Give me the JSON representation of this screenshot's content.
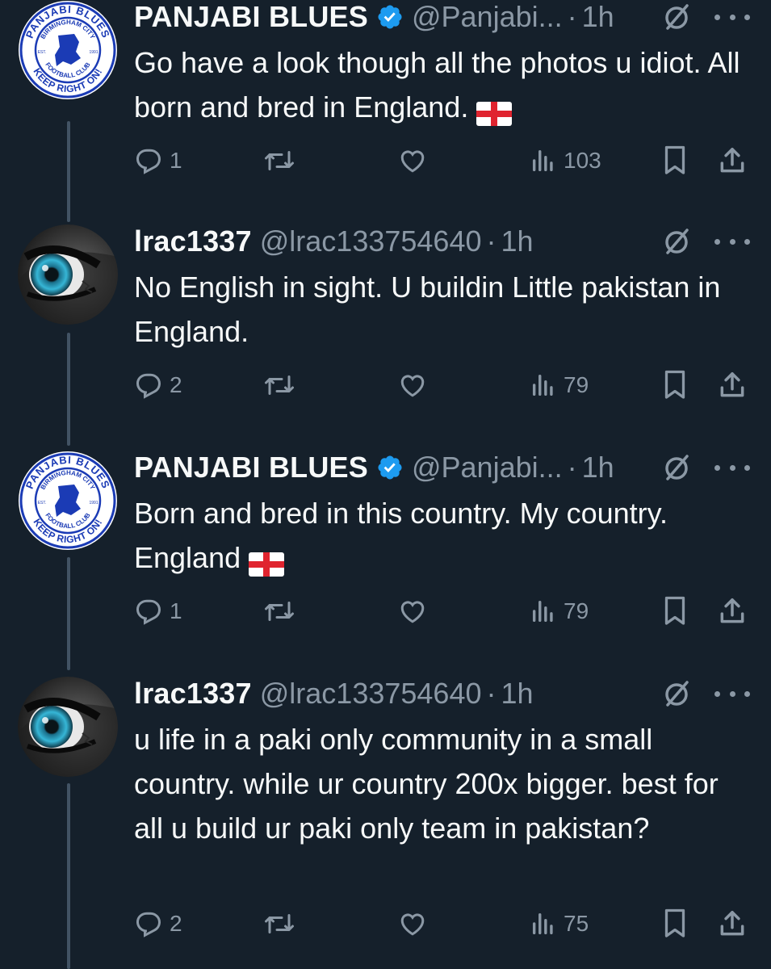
{
  "colors": {
    "background": "#15202b",
    "text_primary": "#f7f9f9",
    "text_secondary": "#8b98a5",
    "verified_blue": "#1d9bf0",
    "thread_line": "#425364"
  },
  "tweets": [
    {
      "author_name": "PANJABI BLUES",
      "handle": "@Panjabi...",
      "time": "1h",
      "verified": true,
      "avatar": "panjabi-blues-logo",
      "avatar_logo_top": "PANJABI BLUES",
      "avatar_logo_mid": "BIRMINGHAM CITY",
      "avatar_logo_sub": "FOOTBALL CLUB",
      "avatar_logo_bottom": "KEEP RIGHT ON!",
      "avatar_est": "EST.",
      "avatar_year": "1991",
      "text": "Go have a look though all the photos u idiot. All born and bred in England.",
      "emoji": "england-flag",
      "replies": "1",
      "views": "103"
    },
    {
      "author_name": "lrac1337",
      "handle": "@lrac133754640",
      "time": "1h",
      "verified": false,
      "avatar": "blue-eye",
      "text": "No English in sight. U buildin Little pakistan in England.",
      "replies": "2",
      "views": "79"
    },
    {
      "author_name": "PANJABI BLUES",
      "handle": "@Panjabi...",
      "time": "1h",
      "verified": true,
      "avatar": "panjabi-blues-logo",
      "avatar_logo_top": "PANJABI BLUES",
      "avatar_logo_mid": "BIRMINGHAM CITY",
      "avatar_logo_sub": "FOOTBALL CLUB",
      "avatar_logo_bottom": "KEEP RIGHT ON!",
      "avatar_est": "EST.",
      "avatar_year": "1991",
      "text": "Born and bred in this country. My country. England",
      "emoji": "england-flag",
      "replies": "1",
      "views": "79"
    },
    {
      "author_name": "lrac1337",
      "handle": "@lrac133754640",
      "time": "1h",
      "verified": false,
      "avatar": "blue-eye",
      "text": "u life in a paki only community in a small country. while ur country 200x bigger. best for all u build ur paki only team in pakistan?",
      "replies": "2",
      "views": "75"
    }
  ],
  "separator": "·"
}
